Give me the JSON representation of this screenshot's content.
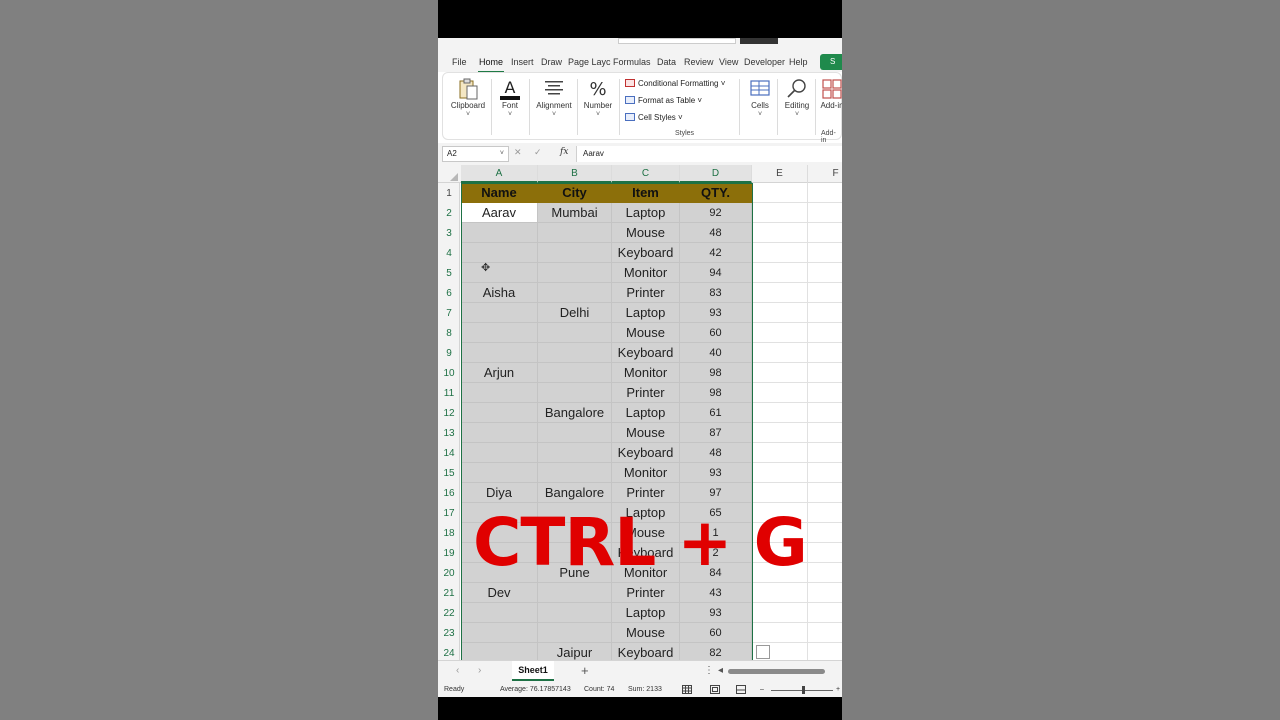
{
  "ribbon": {
    "tabs": [
      "File",
      "Home",
      "Insert",
      "Draw",
      "Page Layc",
      "Formulas",
      "Data",
      "Review",
      "View",
      "Developer",
      "Help"
    ],
    "share_label": "S",
    "groups": {
      "clipboard": "Clipboard",
      "font": "Font",
      "alignment": "Alignment",
      "number": "Number",
      "cells": "Cells",
      "editing": "Editing",
      "addins": "Add-in"
    },
    "styles": {
      "conditional": "Conditional Formatting ˅",
      "table": "Format as Table ˅",
      "cell_styles": "Cell Styles ˅",
      "label": "Styles",
      "addins_label": "Add-in"
    },
    "chevron": "˅"
  },
  "formula_bar": {
    "name_box": "A2",
    "name_dd": "˅",
    "buttons": "✕ ✓",
    "fx": "fx",
    "value": "Aarav"
  },
  "grid": {
    "columns": [
      "A",
      "B",
      "C",
      "D",
      "E",
      "F"
    ],
    "header": [
      "Name",
      "City",
      "Item",
      "QTY."
    ],
    "rows": [
      {
        "n": "2",
        "a": "Aarav",
        "b": "Mumbai",
        "c": "Laptop",
        "d": "92"
      },
      {
        "n": "3",
        "a": "",
        "b": "",
        "c": "Mouse",
        "d": "48"
      },
      {
        "n": "4",
        "a": "",
        "b": "",
        "c": "Keyboard",
        "d": "42"
      },
      {
        "n": "5",
        "a": "",
        "b": "",
        "c": "Monitor",
        "d": "94"
      },
      {
        "n": "6",
        "a": "Aisha",
        "b": "",
        "c": "Printer",
        "d": "83"
      },
      {
        "n": "7",
        "a": "",
        "b": "Delhi",
        "c": "Laptop",
        "d": "93"
      },
      {
        "n": "8",
        "a": "",
        "b": "",
        "c": "Mouse",
        "d": "60"
      },
      {
        "n": "9",
        "a": "",
        "b": "",
        "c": "Keyboard",
        "d": "40"
      },
      {
        "n": "10",
        "a": "Arjun",
        "b": "",
        "c": "Monitor",
        "d": "98"
      },
      {
        "n": "11",
        "a": "",
        "b": "",
        "c": "Printer",
        "d": "98"
      },
      {
        "n": "12",
        "a": "",
        "b": "Bangalore",
        "c": "Laptop",
        "d": "61"
      },
      {
        "n": "13",
        "a": "",
        "b": "",
        "c": "Mouse",
        "d": "87"
      },
      {
        "n": "14",
        "a": "",
        "b": "",
        "c": "Keyboard",
        "d": "48"
      },
      {
        "n": "15",
        "a": "",
        "b": "",
        "c": "Monitor",
        "d": "93"
      },
      {
        "n": "16",
        "a": "Diya",
        "b": "Bangalore",
        "c": "Printer",
        "d": "97"
      },
      {
        "n": "17",
        "a": "",
        "b": "",
        "c": "Laptop",
        "d": "65"
      },
      {
        "n": "18",
        "a": "",
        "b": "",
        "c": "Mouse",
        "d": "1"
      },
      {
        "n": "19",
        "a": "",
        "b": "",
        "c": "Keyboard",
        "d": "2"
      },
      {
        "n": "20",
        "a": "",
        "b": "Pune",
        "c": "Monitor",
        "d": "84"
      },
      {
        "n": "21",
        "a": "Dev",
        "b": "",
        "c": "Printer",
        "d": "43"
      },
      {
        "n": "22",
        "a": "",
        "b": "",
        "c": "Laptop",
        "d": "93"
      },
      {
        "n": "23",
        "a": "",
        "b": "",
        "c": "Mouse",
        "d": "60"
      },
      {
        "n": "24",
        "a": "",
        "b": "Jaipur",
        "c": "Keyboard",
        "d": "82"
      }
    ]
  },
  "overlay_text": "CTRL + G",
  "sheets": {
    "prev": "‹",
    "next": "›",
    "active": "Sheet1",
    "add": "+",
    "more": "⋮",
    "scroll_left": "◂"
  },
  "status": {
    "ready": "Ready",
    "average": "Average: 76.17857143",
    "count": "Count: 74",
    "sum": "Sum: 2133",
    "zoom_minus": "–",
    "zoom_plus": "+"
  },
  "colors": {
    "accent": "#1e7145",
    "header_fill": "#8c6f0a",
    "overlay": "#e00000",
    "selection_fill": "#d2d2d2"
  }
}
